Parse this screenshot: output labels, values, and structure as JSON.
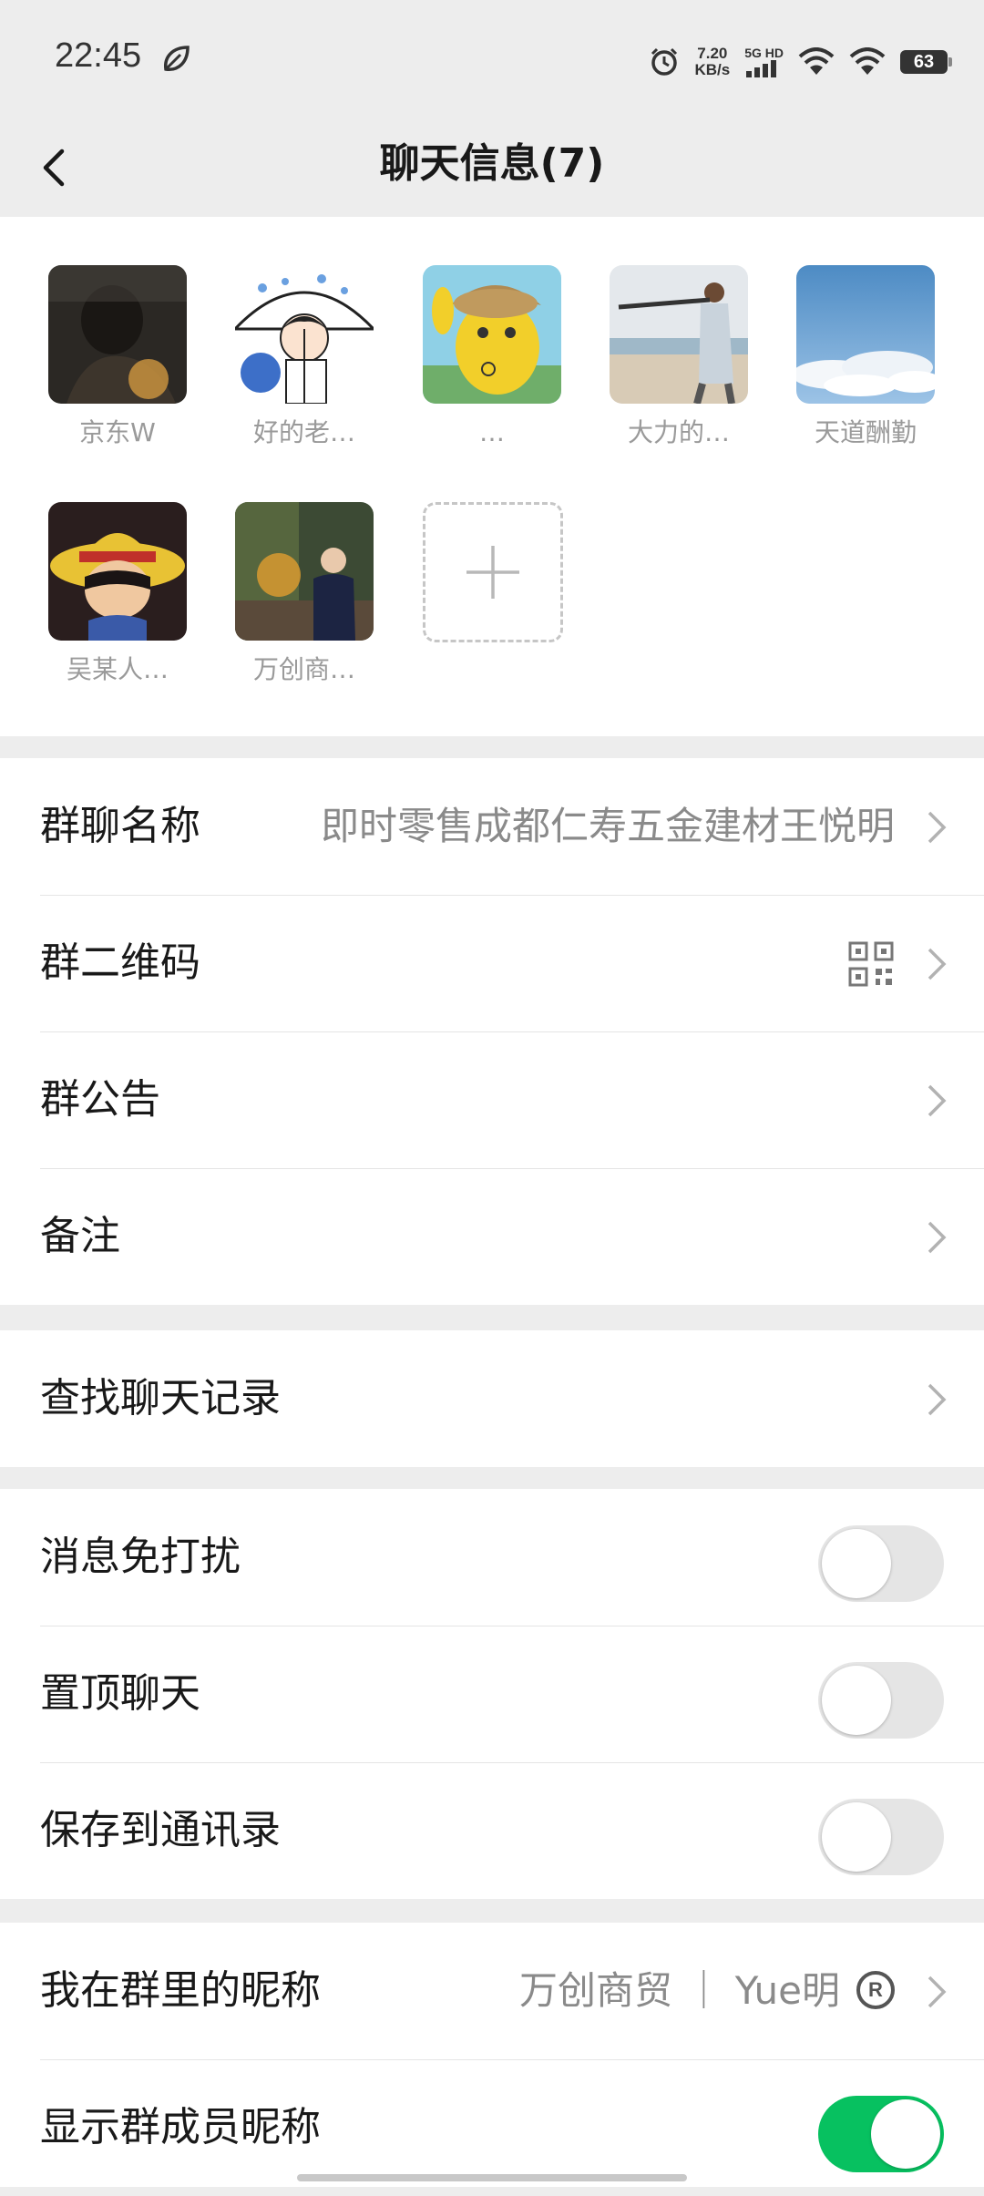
{
  "status_bar": {
    "time": "22:45",
    "net_speed_value": "7.20",
    "net_speed_unit": "KB/s",
    "network_label": "5G HD",
    "battery": "63",
    "icons": [
      "leaf-icon",
      "alarm-icon",
      "signal-icon",
      "wifi-icon",
      "wifi-icon",
      "battery-icon"
    ]
  },
  "header": {
    "title": "聊天信息(7)",
    "back_icon": "chevron-left-icon"
  },
  "members": [
    {
      "name": "京东W",
      "avatar_colors": [
        "#3a3530",
        "#8a6a40"
      ]
    },
    {
      "name": "好的老…",
      "avatar_colors": [
        "#ffffff",
        "#4a7fd0"
      ]
    },
    {
      "name": "…",
      "avatar_colors": [
        "#7ec8e3",
        "#f0d040"
      ]
    },
    {
      "name": "大力的…",
      "avatar_colors": [
        "#d8d0c4",
        "#8fb0c8"
      ]
    },
    {
      "name": "天道酬勤",
      "avatar_colors": [
        "#5c94c8",
        "#eef3f8"
      ]
    },
    {
      "name": "吴某人…",
      "avatar_colors": [
        "#2a2020",
        "#e8c030"
      ]
    },
    {
      "name": "万创商…",
      "avatar_colors": [
        "#4a5a3a",
        "#1c2440"
      ]
    }
  ],
  "add_member_icon": "plus-icon",
  "group_section": {
    "group_name_label": "群聊名称",
    "group_name_value": "即时零售成都仁寿五金建材王悦明",
    "qr_code_label": "群二维码",
    "announcement_label": "群公告",
    "remark_label": "备注"
  },
  "search_section": {
    "search_history_label": "查找聊天记录"
  },
  "settings_section": {
    "mute_label": "消息免打扰",
    "mute_on": false,
    "pin_label": "置顶聊天",
    "pin_on": false,
    "save_contacts_label": "保存到通讯录",
    "save_contacts_on": false
  },
  "nickname_section": {
    "my_nickname_label": "我在群里的昵称",
    "my_nickname_value": "万创商贸 ｜ Yue明",
    "reg_mark": "R",
    "show_nicknames_label": "显示群成员昵称",
    "show_nicknames_on": true
  },
  "colors": {
    "background": "#ededed",
    "toggle_on": "#07c160",
    "toggle_off": "#e5e5e5"
  }
}
